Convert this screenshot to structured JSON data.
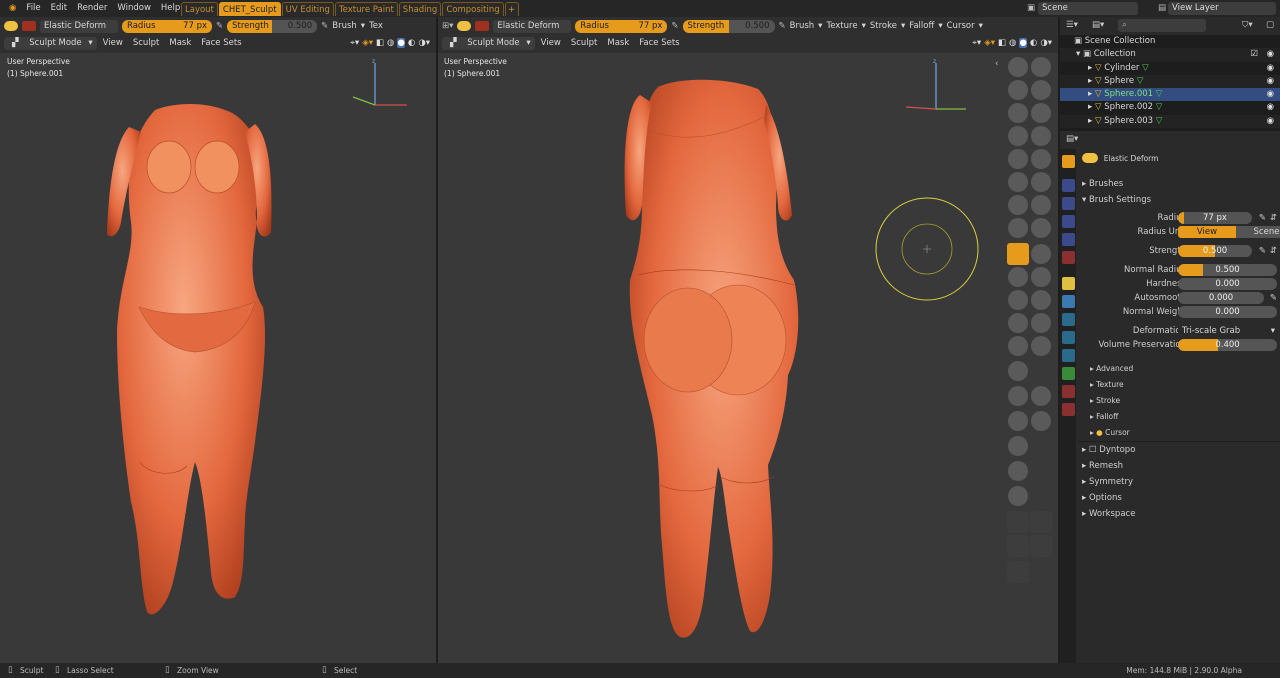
{
  "app": {
    "logo_icon": "blender-icon"
  },
  "menus": [
    "File",
    "Edit",
    "Render",
    "Window",
    "Help"
  ],
  "workspaces": [
    {
      "label": "Layout",
      "active": false
    },
    {
      "label": "CHET_Sculpt",
      "active": true
    },
    {
      "label": "UV Editing",
      "active": false
    },
    {
      "label": "Texture Paint",
      "active": false
    },
    {
      "label": "Shading",
      "active": false
    },
    {
      "label": "Compositing",
      "active": false
    }
  ],
  "scene": {
    "label": "Scene",
    "view_layer": "View Layer"
  },
  "left_vp": {
    "brush_name": "Elastic Deform",
    "radius_label": "Radius",
    "radius_value": "77 px",
    "strength_label": "Strength",
    "strength_value": "0.500",
    "brush_menu": "Brush",
    "tex_menu": "Tex",
    "mode": "Sculpt Mode",
    "menus": [
      "View",
      "Sculpt",
      "Mask",
      "Face Sets"
    ],
    "perspective": "User Perspective",
    "object": "(1) Sphere.001"
  },
  "right_vp": {
    "brush_name": "Elastic Deform",
    "radius_label": "Radius",
    "radius_value": "77 px",
    "strength_label": "Strength",
    "strength_value": "0.500",
    "header_menus": [
      "Brush",
      "Texture",
      "Stroke",
      "Falloff",
      "Cursor"
    ],
    "mode": "Sculpt Mode",
    "menus": [
      "View",
      "Sculpt",
      "Mask",
      "Face Sets"
    ],
    "perspective": "User Perspective",
    "object": "(1) Sphere.001"
  },
  "outliner": {
    "search_placeholder": "",
    "items": [
      {
        "label": "Scene Collection",
        "depth": 0
      },
      {
        "label": "Collection",
        "depth": 1
      },
      {
        "label": "Cylinder",
        "depth": 2
      },
      {
        "label": "Sphere",
        "depth": 2
      },
      {
        "label": "Sphere.001",
        "depth": 2,
        "selected": true
      },
      {
        "label": "Sphere.002",
        "depth": 2
      },
      {
        "label": "Sphere.003",
        "depth": 2
      }
    ]
  },
  "properties": {
    "brush": "Elastic Deform",
    "sections": {
      "brushes": "Brushes",
      "brush_settings": "Brush Settings"
    },
    "radius": {
      "label": "Radius",
      "value": "77 px",
      "fill": 0.0
    },
    "radius_unit": {
      "label": "Radius Unit",
      "view": "View",
      "scene": "Scene"
    },
    "strength": {
      "label": "Strength",
      "value": "0.500",
      "fill": 0.5
    },
    "normal_radius": {
      "label": "Normal Radius",
      "value": "0.500",
      "fill": 0.25
    },
    "hardness": {
      "label": "Hardness",
      "value": "0.000",
      "fill": 0.0
    },
    "autosmooth": {
      "label": "Autosmooth",
      "value": "0.000",
      "fill": 0.0
    },
    "normal_weight": {
      "label": "Normal Weight",
      "value": "0.000",
      "fill": 0.0
    },
    "deformation": {
      "label": "Deformation",
      "value": "Tri-scale Grab"
    },
    "volume_preservation": {
      "label": "Volume Preservation",
      "value": "0.400",
      "fill": 0.4
    },
    "subsections": [
      "Advanced",
      "Texture",
      "Stroke",
      "Falloff",
      "Cursor"
    ],
    "panels": [
      "Dyntopo",
      "Remesh",
      "Symmetry",
      "Options",
      "Workspace"
    ]
  },
  "status": {
    "sculpt": "Sculpt",
    "lasso": "Lasso Select",
    "zoom": "Zoom View",
    "select": "Select",
    "mem": "Mem: 144.8 MiB | 2.90.0 Alpha"
  },
  "colors": {
    "accent": "#e69b1c",
    "selection": "#334d80",
    "skin": "#e8724a"
  }
}
